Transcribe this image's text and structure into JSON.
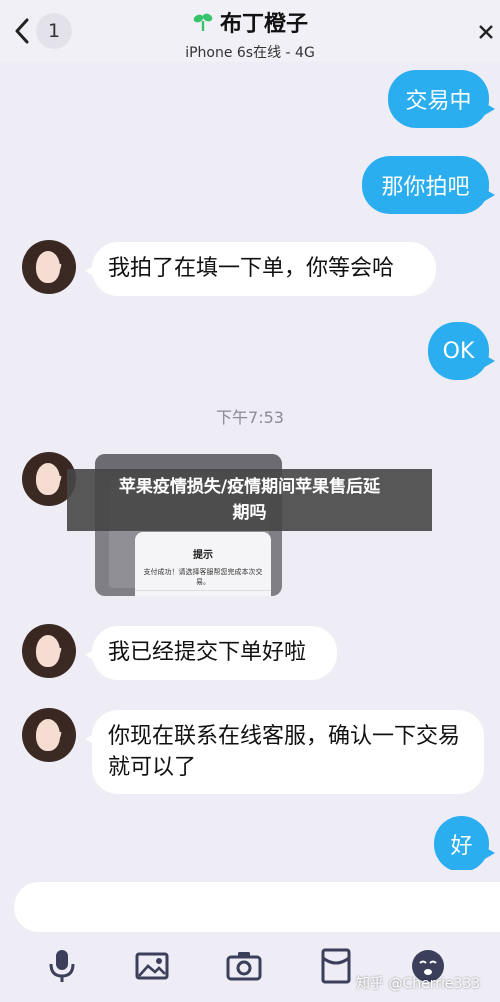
{
  "header": {
    "back_count": "1",
    "title": "布丁橙子",
    "subtitle": "iPhone 6s在线 - 4G"
  },
  "messages": {
    "out1": "交易中",
    "out2": "那你拍吧",
    "in1": "我拍了在填一下单，你等会哈",
    "out3": "OK",
    "time": "下午7:53",
    "in3": "我已经提交下单好啦",
    "in4": "你现在联系在线客服，确认一下交易就可以了",
    "out4": "好"
  },
  "image_message": {
    "tabs": [
      "",
      "",
      "",
      ""
    ],
    "dialog_title": "提示",
    "dialog_message": "支付成功！请选择客服帮您完成本次交易。",
    "dialog_button": "好"
  },
  "overlay": {
    "line1": "苹果疫情损失/疫情期间苹果售后延",
    "line2": "期吗"
  },
  "input": {
    "placeholder": ""
  },
  "toolbar": [
    "mic-icon",
    "image-icon",
    "camera-icon",
    "red-packet-icon",
    "emoji-icon"
  ],
  "watermark": "知乎 @Cherrie333",
  "colors": {
    "bubble_out": "#2baeef",
    "background": "#eeedf5",
    "bubble_in": "#ffffff"
  }
}
